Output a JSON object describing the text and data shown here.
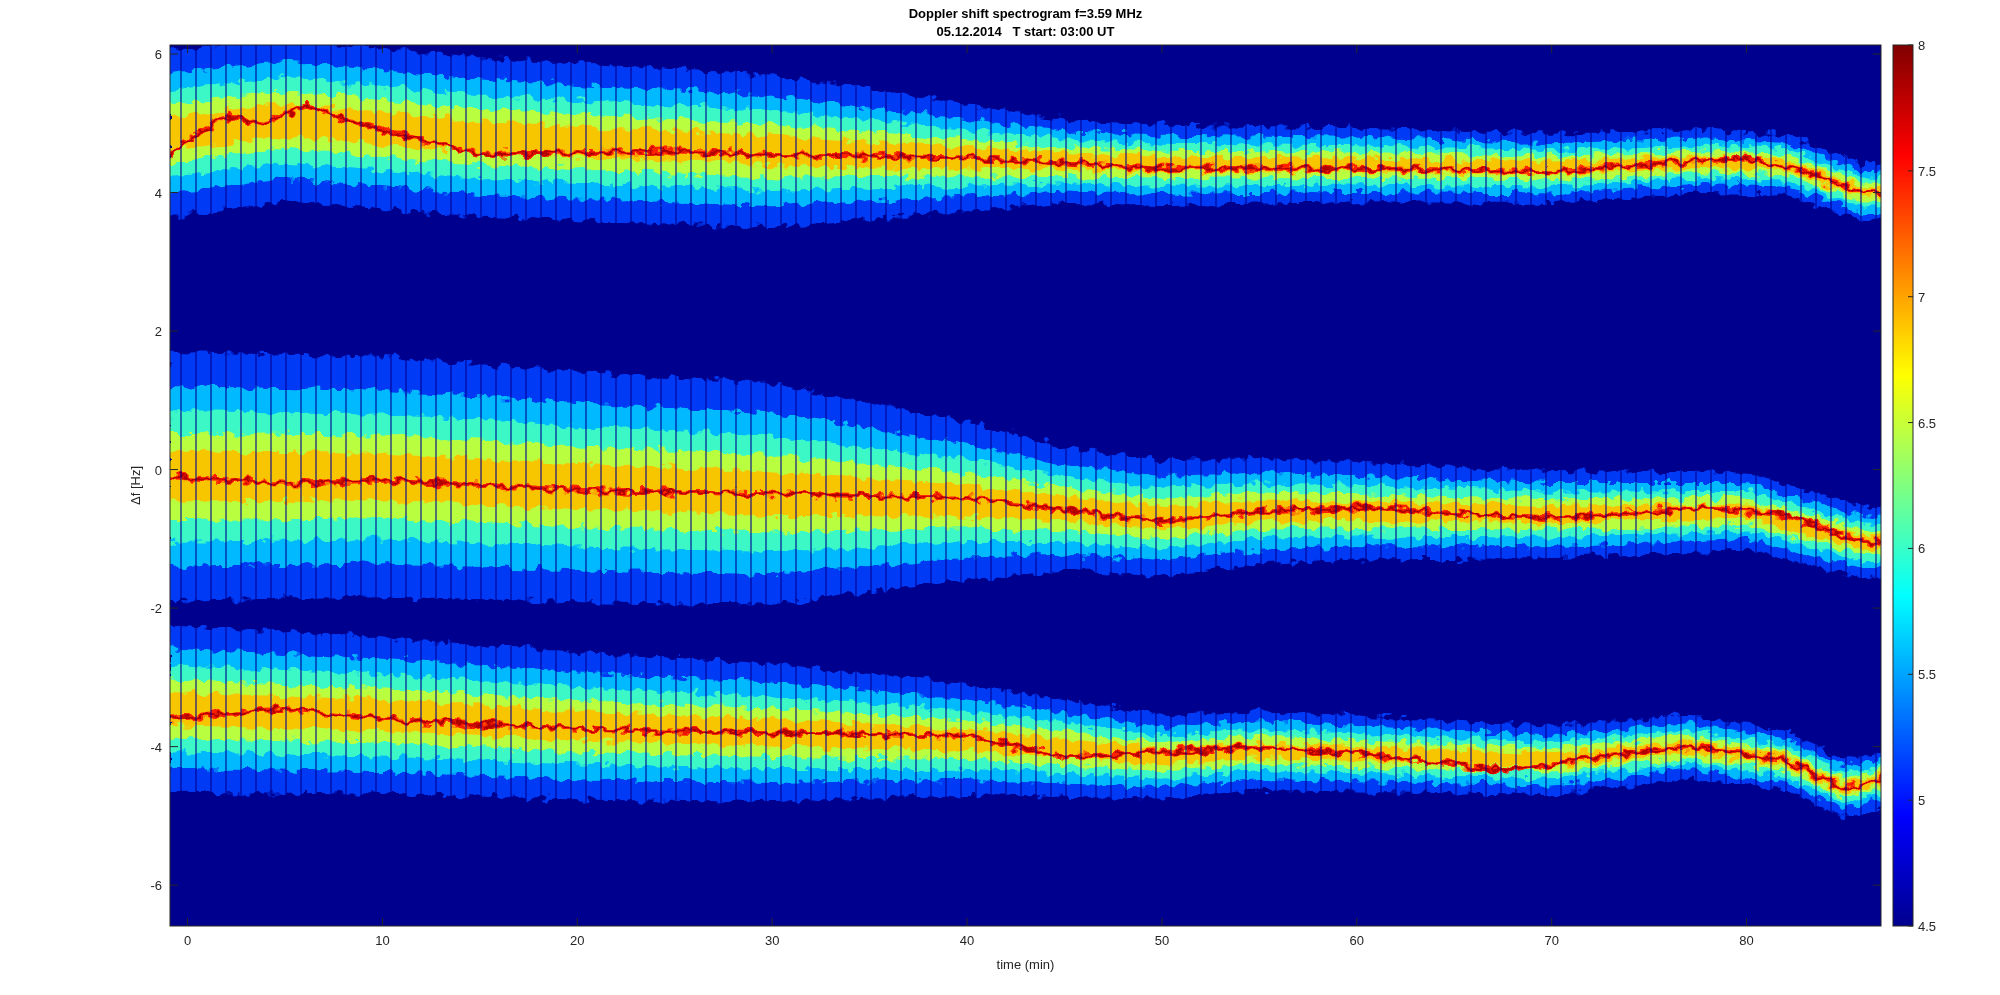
{
  "figure": {
    "title_lines": [
      "Doppler shift spectrogram f=3.59 MHz",
      "05.12.2014   T start: 03:00 UT"
    ]
  },
  "axes": {
    "xlabel": "time (min)",
    "ylabel": "Δf [Hz]",
    "xticks": [
      "0",
      "10",
      "20",
      "30",
      "40",
      "50",
      "60",
      "70",
      "80"
    ],
    "yticks": [
      "6",
      "4",
      "2",
      "0",
      "-2",
      "-4",
      "-6"
    ]
  },
  "colorbar": {
    "ticks": [
      "8",
      "7.5",
      "7",
      "6.5",
      "6",
      "5.5",
      "5",
      "4.5"
    ]
  }
}
